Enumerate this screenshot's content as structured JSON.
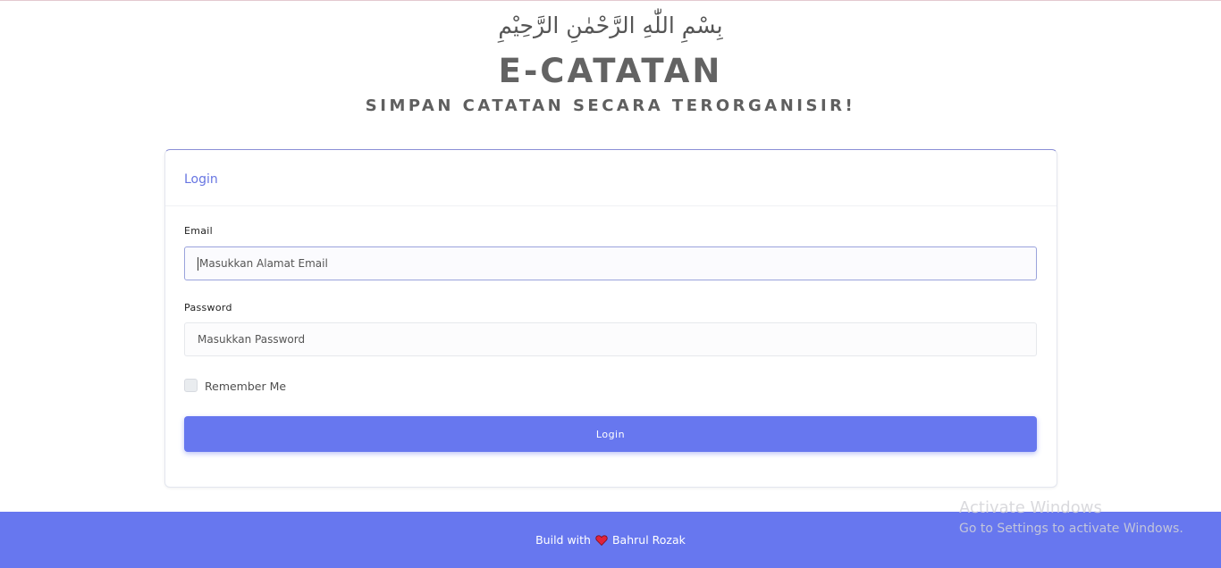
{
  "header": {
    "bismillah": "بِسْمِ اللّٰهِ الرَّحْمٰنِ الرَّحِيْمِ",
    "title": "E-CATATAN",
    "subtitle": "SIMPAN CATATAN SECARA TERORGANISIR!"
  },
  "card": {
    "title": "Login",
    "email_label": "Email",
    "email_placeholder": "Masukkan Alamat Email",
    "password_label": "Password",
    "password_placeholder": "Masukkan Password",
    "remember_label": "Remember Me",
    "login_button": "Login"
  },
  "footer": {
    "prefix": "Build with",
    "author": "Bahrul Rozak",
    "heart_icon": "heart-icon"
  },
  "watermark": {
    "title": "Activate Windows",
    "subtitle": "Go to Settings to activate Windows."
  },
  "colors": {
    "accent": "#6777ef",
    "heart": "#e0233a"
  }
}
